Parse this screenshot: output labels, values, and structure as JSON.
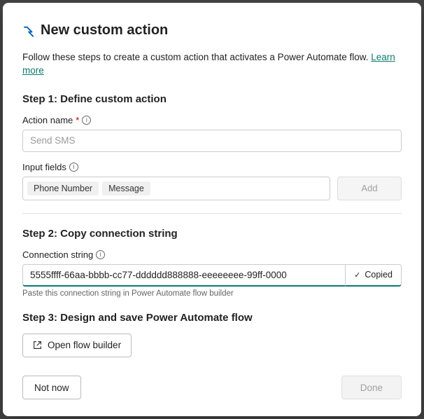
{
  "title": "New custom action",
  "intro_text": "Follow these steps to create a custom action that activates a Power Automate flow. ",
  "learn_more": "Learn more",
  "step1": {
    "heading": "Step 1: Define custom action",
    "action_name_label": "Action name",
    "action_name_placeholder": "Send SMS",
    "input_fields_label": "Input fields",
    "tags": [
      "Phone Number",
      "Message"
    ],
    "add_button": "Add"
  },
  "step2": {
    "heading": "Step 2: Copy connection string",
    "conn_label": "Connection string",
    "conn_value": "5555ffff-66aa-bbbb-cc77-dddddd888888-eeeeeeee-99ff-0000",
    "copied_label": "Copied",
    "helper": "Paste this connection string in Power Automate flow builder"
  },
  "step3": {
    "heading": "Step 3: Design and save Power Automate flow",
    "open_builder": "Open flow builder"
  },
  "footer": {
    "not_now": "Not now",
    "done": "Done"
  }
}
